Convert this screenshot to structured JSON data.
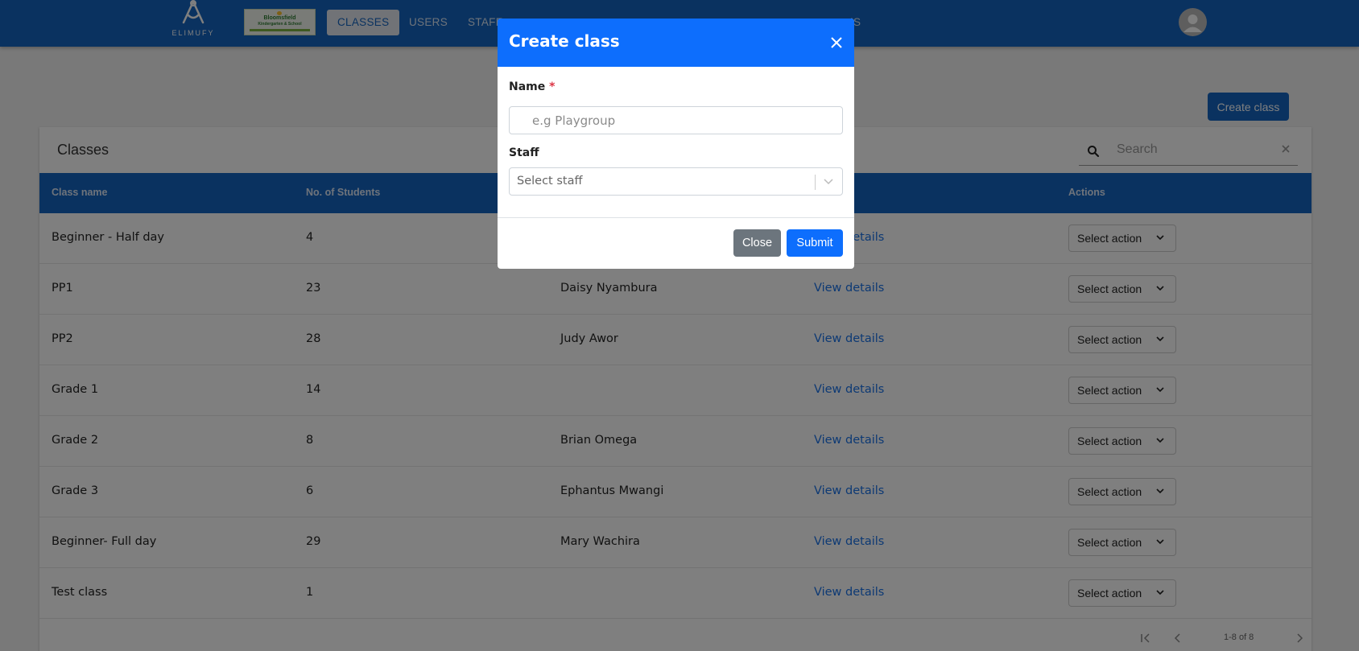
{
  "header": {
    "brand_text": "ELIMUFY",
    "school_logo_line1": "Bloomsfield",
    "school_logo_line2": "Kindergarten & School",
    "nav": [
      "CLASSES",
      "USERS",
      "STAFF",
      "IS"
    ]
  },
  "page": {
    "create_button": "Create class"
  },
  "table": {
    "title": "Classes",
    "search_placeholder": "Search",
    "columns": [
      "Class name",
      "No. of Students",
      "",
      "",
      "Actions"
    ],
    "rows": [
      {
        "name": "Beginner - Half day",
        "students": "4",
        "teacher": "",
        "link": "View details",
        "action": "Select action"
      },
      {
        "name": "PP1",
        "students": "23",
        "teacher": "Daisy Nyambura",
        "link": "View details",
        "action": "Select action"
      },
      {
        "name": "PP2",
        "students": "28",
        "teacher": "Judy Awor",
        "link": "View details",
        "action": "Select action"
      },
      {
        "name": "Grade 1",
        "students": "14",
        "teacher": "",
        "link": "View details",
        "action": "Select action"
      },
      {
        "name": "Grade 2",
        "students": "8",
        "teacher": "Brian Omega",
        "link": "View details",
        "action": "Select action"
      },
      {
        "name": "Grade 3",
        "students": "6",
        "teacher": "Ephantus Mwangi",
        "link": "View details",
        "action": "Select action"
      },
      {
        "name": "Beginner- Full day",
        "students": "29",
        "teacher": "Mary Wachira",
        "link": "View details",
        "action": "Select action"
      },
      {
        "name": "Test class",
        "students": "1",
        "teacher": "",
        "link": "View details",
        "action": "Select action"
      }
    ],
    "pagination": "1-8 of 8"
  },
  "modal": {
    "title": "Create class",
    "name_label": "Name",
    "required_mark": "*",
    "name_placeholder": "e.g Playgroup",
    "staff_label": "Staff",
    "staff_placeholder": "Select staff",
    "close_button": "Close",
    "submit_button": "Submit"
  },
  "colors": {
    "header_blue": "#1565c0",
    "modal_blue": "#0d6efd",
    "link_blue": "#1a73e8",
    "close_grey": "#6c757d"
  }
}
